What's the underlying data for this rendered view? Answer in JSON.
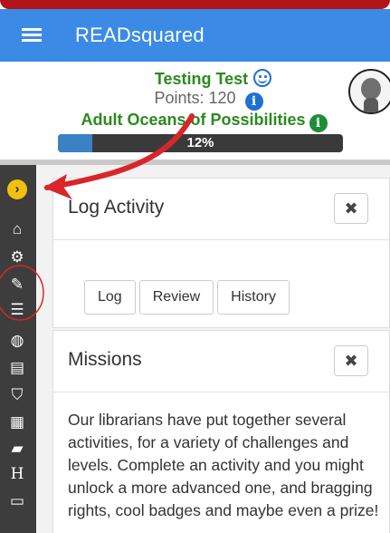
{
  "app": {
    "title": "READsquared"
  },
  "profile": {
    "name": "Testing Test",
    "points": "Points: 120",
    "program": "Adult Oceans of Possibilities",
    "progress_percent": 12,
    "progress_label": "12%"
  },
  "icons": {
    "menu": "hamburger-icon",
    "smile": "smile-icon",
    "info": "info-icon",
    "avatar": "avatar-icon"
  },
  "sidebar": {
    "items": [
      {
        "name": "expand",
        "glyph": "›"
      },
      {
        "name": "home",
        "glyph": "⌂"
      },
      {
        "name": "settings",
        "glyph": "⚙"
      },
      {
        "name": "log",
        "glyph": "✎"
      },
      {
        "name": "list",
        "glyph": "☰"
      },
      {
        "name": "games",
        "glyph": "◍"
      },
      {
        "name": "map",
        "glyph": "▤"
      },
      {
        "name": "badge",
        "glyph": "⛉"
      },
      {
        "name": "calendar",
        "glyph": "▦"
      },
      {
        "name": "book",
        "glyph": "▰"
      },
      {
        "name": "h",
        "glyph": "H"
      },
      {
        "name": "reading",
        "glyph": "▭"
      }
    ]
  },
  "log_activity": {
    "title": "Log Activity",
    "close": "✖",
    "buttons": [
      "Log",
      "Review",
      "History"
    ]
  },
  "missions": {
    "title": "Missions",
    "close": "✖",
    "text": "Our librarians have put together several activities, for a variety of challenges and levels. Complete an activity and you might unlock a more advanced one, and bragging rights, cool badges and maybe even a prize!"
  },
  "colors": {
    "appbar": "#3b8be6",
    "accent_red": "#d8262a",
    "green": "#2b8a1e",
    "progress_fill": "#3b82c4"
  }
}
